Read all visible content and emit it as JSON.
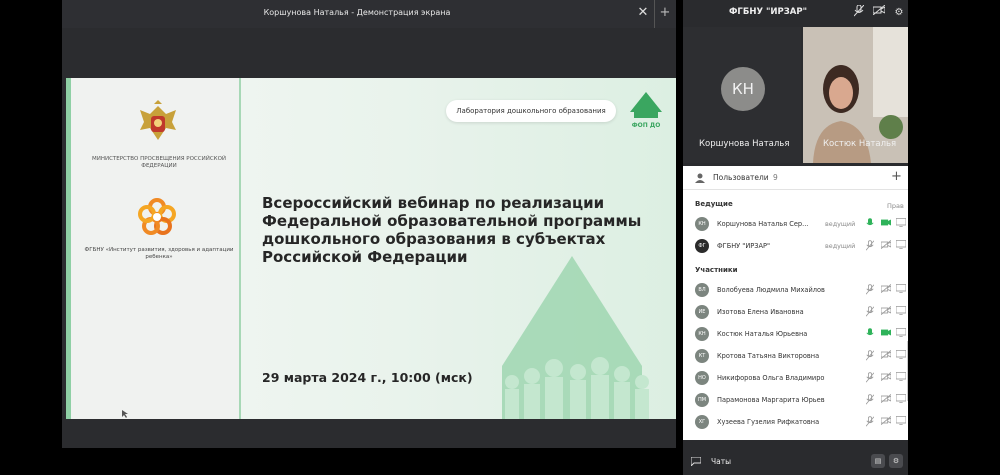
{
  "share": {
    "title": "Коршунова Наталья - Демонстрация экрана",
    "close_icon": "close-icon",
    "add_icon": "plus-icon"
  },
  "slide": {
    "ministry": "МИНИСТЕРСТВО ПРОСВЕЩЕНИЯ РОССИЙСКОЙ ФЕДЕРАЦИИ",
    "institute": "ФГБНУ «Институт развития, здоровья и адаптации ребенка»",
    "lab": "Лаборатория дошкольного образования",
    "fgos_logo": "ФОП ДО",
    "title": "Всероссийский вебинар по реализации Федеральной образовательной программы дошкольного образования в субъектах Российской Федерации",
    "date": "29 марта 2024 г., 10:00 (мск)"
  },
  "panel": {
    "title": "ФГБНУ \"ИРЗАР\"",
    "tile_a": {
      "initials": "КН",
      "name": "Коршунова Наталья"
    },
    "tile_b": {
      "name": "Костюк Наталья"
    }
  },
  "users": {
    "title": "Пользователи",
    "count": "9",
    "hosts_label": "Ведущие",
    "rights_label": "Прав",
    "participants_label": "Участники",
    "hosts": [
      {
        "initials": "КН",
        "name": "Коршунова Наталья Сер...",
        "role": "ведущий",
        "mic": "on",
        "avatar_color": "#7c857f"
      },
      {
        "initials": "ФГ",
        "name": "ФГБНУ \"ИРЗАР\"",
        "role": "ведущий",
        "mic": "off",
        "avatar_color": "#2b2b2b"
      }
    ],
    "participants": [
      {
        "initials": "ВЛ",
        "name": "Волобуева Людмила Михайловна",
        "mic": "off"
      },
      {
        "initials": "ИЕ",
        "name": "Изотова Елена Ивановна",
        "mic": "off"
      },
      {
        "initials": "КН",
        "name": "Костюк Наталья Юрьевна",
        "mic": "on"
      },
      {
        "initials": "КТ",
        "name": "Кротова Татьяна Викторовна",
        "mic": "off"
      },
      {
        "initials": "НО",
        "name": "Никифорова Ольга Владимировна",
        "mic": "off"
      },
      {
        "initials": "ПМ",
        "name": "Парамонова Маргарита Юрьевна",
        "mic": "off"
      },
      {
        "initials": "ХГ",
        "name": "Хузеева Гузелия Рифкатовна",
        "mic": "off"
      }
    ]
  },
  "chats": {
    "label": "Чаты"
  },
  "colors": {
    "accent_green": "#2fb35a",
    "slide_green": "#8fd0a5",
    "panel_dark": "#2a2b2e"
  }
}
